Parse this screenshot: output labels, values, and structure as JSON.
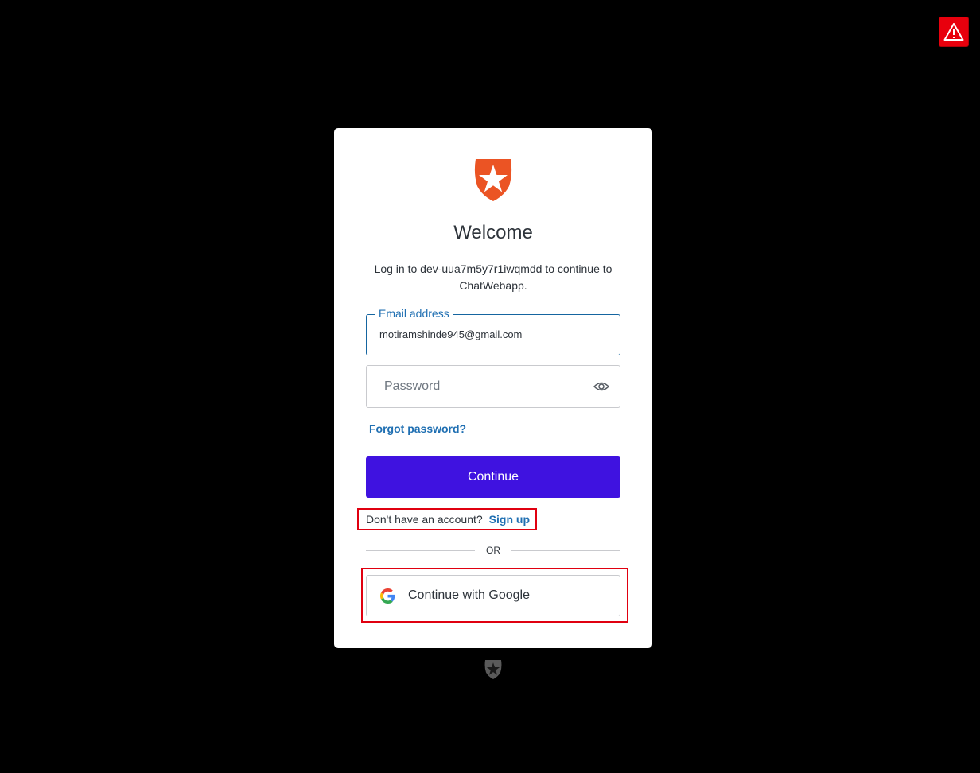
{
  "header": {
    "warning_icon": "warning-triangle-icon"
  },
  "login": {
    "logo_icon": "shield-star-icon",
    "title": "Welcome",
    "subtitle": "Log in to dev-uua7m5y7r1iwqmdd to continue to ChatWebapp.",
    "email": {
      "label": "Email address",
      "value": "motiramshinde945@gmail.com"
    },
    "password": {
      "placeholder": "Password",
      "toggle_icon": "eye-icon"
    },
    "forgot_password": "Forgot password?",
    "continue_label": "Continue",
    "signup_prompt": "Don't have an account?",
    "signup_link": "Sign up",
    "divider": "OR",
    "google_label": "Continue with Google",
    "google_icon": "google-icon"
  },
  "footer": {
    "badge_icon": "shield-star-icon"
  },
  "colors": {
    "background": "#000000",
    "card": "#ffffff",
    "brand": "#eb5424",
    "primary_button": "#3f12e0",
    "link": "#1f6fb2",
    "highlight": "#e00010",
    "warning": "#e8000d"
  }
}
